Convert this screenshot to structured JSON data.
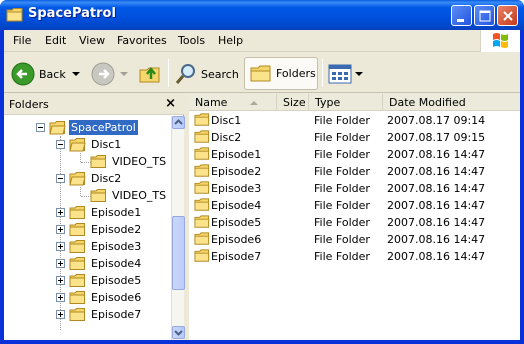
{
  "window": {
    "title": "SpacePatrol"
  },
  "menu": [
    {
      "key": "F",
      "rest": "ile"
    },
    {
      "key": "E",
      "rest": "dit"
    },
    {
      "key": "V",
      "rest": "iew"
    },
    {
      "key": "",
      "pre": "F",
      "key2": "a",
      "rest": "vorites"
    },
    {
      "key": "T",
      "rest": "ools"
    },
    {
      "key": "H",
      "rest": "elp"
    }
  ],
  "menu_labels": {
    "file": "File",
    "edit": "Edit",
    "view": "View",
    "favorites": "Favorites",
    "tools": "Tools",
    "help": "Help"
  },
  "toolbar": {
    "back": "Back",
    "search": "Search",
    "folders": "Folders"
  },
  "folders_pane": {
    "title": "Folders",
    "close": "×"
  },
  "tree": [
    {
      "label": "SpacePatrol",
      "selected": true
    },
    {
      "label": "Disc1"
    },
    {
      "label": "VIDEO_TS"
    },
    {
      "label": "Disc2"
    },
    {
      "label": "VIDEO_TS"
    },
    {
      "label": "Episode1"
    },
    {
      "label": "Episode2"
    },
    {
      "label": "Episode3"
    },
    {
      "label": "Episode4"
    },
    {
      "label": "Episode5"
    },
    {
      "label": "Episode6"
    },
    {
      "label": "Episode7"
    }
  ],
  "columns": {
    "name": "Name",
    "size": "Size",
    "type": "Type",
    "date": "Date Modified"
  },
  "files": [
    {
      "name": "Disc1",
      "type": "File Folder",
      "date": "2007.08.17 09:14"
    },
    {
      "name": "Disc2",
      "type": "File Folder",
      "date": "2007.08.17 09:15"
    },
    {
      "name": "Episode1",
      "type": "File Folder",
      "date": "2007.08.16 14:47"
    },
    {
      "name": "Episode2",
      "type": "File Folder",
      "date": "2007.08.16 14:47"
    },
    {
      "name": "Episode3",
      "type": "File Folder",
      "date": "2007.08.16 14:47"
    },
    {
      "name": "Episode4",
      "type": "File Folder",
      "date": "2007.08.16 14:47"
    },
    {
      "name": "Episode5",
      "type": "File Folder",
      "date": "2007.08.16 14:47"
    },
    {
      "name": "Episode6",
      "type": "File Folder",
      "date": "2007.08.16 14:47"
    },
    {
      "name": "Episode7",
      "type": "File Folder",
      "date": "2007.08.16 14:47"
    }
  ],
  "colors": {
    "titlebar": "#0058e6",
    "selection": "#316ac5",
    "folder": "#f6d56a"
  }
}
